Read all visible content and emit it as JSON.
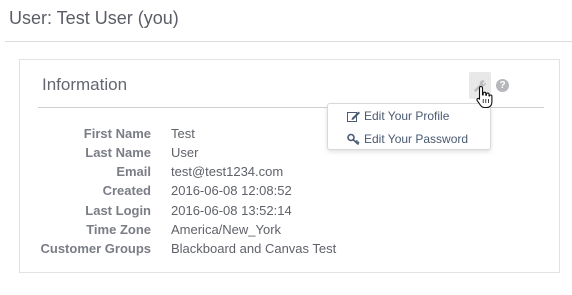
{
  "header": {
    "title": "User: Test User (you)"
  },
  "panel": {
    "title": "Information",
    "help_glyph": "?"
  },
  "menu": {
    "items": [
      {
        "label": "Edit Your Profile",
        "icon": "edit-icon"
      },
      {
        "label": "Edit Your Password",
        "icon": "key-icon"
      }
    ]
  },
  "info": [
    {
      "label": "First Name",
      "value": "Test"
    },
    {
      "label": "Last Name",
      "value": "User"
    },
    {
      "label": "Email",
      "value": "test@test1234.com"
    },
    {
      "label": "Created",
      "value": "2016-06-08 12:08:52"
    },
    {
      "label": "Last Login",
      "value": "2016-06-08 13:52:14"
    },
    {
      "label": "Time Zone",
      "value": "America/New_York"
    },
    {
      "label": "Customer Groups",
      "value": "Blackboard and Canvas Test"
    }
  ],
  "colors": {
    "text": "#5e6066",
    "label": "#7a7d85",
    "link": "#4a5a72",
    "rule": "#dcdcdc"
  }
}
